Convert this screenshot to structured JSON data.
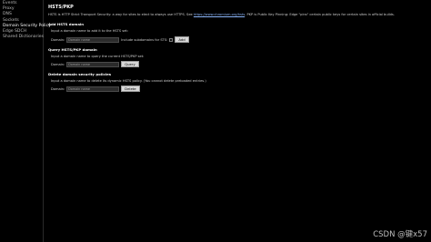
{
  "sidebar": {
    "items": [
      {
        "label": "Events",
        "active": false
      },
      {
        "label": "Proxy",
        "active": false
      },
      {
        "label": "DNS",
        "active": false
      },
      {
        "label": "Sockets",
        "active": false
      },
      {
        "label": "Domain Security Policy",
        "active": true
      },
      {
        "label": "Edge SDCH",
        "active": false
      },
      {
        "label": "Shared Dictionaries",
        "active": false
      }
    ]
  },
  "main": {
    "title": "HSTS/PKP",
    "intro": {
      "before_link": "HSTS is HTTP Strict Transport Security: a way for sites to elect to always use HTTPS. See ",
      "link": "https://www.chromium.org/hsts",
      "after_link": ". PKP is Public Key Pinning: Edge \"pins\" certain public keys for certain sites in official builds."
    },
    "add": {
      "title": "Add HSTS domain",
      "description": "Input a domain name to add it to the HSTS set:",
      "domain_label": "Domain:",
      "domain_placeholder": "Domain name",
      "subdomains_label": "Include subdomains for STS:",
      "button": "Add"
    },
    "query": {
      "title": "Query HSTS/PKP domain",
      "description": "Input a domain name to query the current HSTS/PKP set:",
      "domain_label": "Domain:",
      "domain_placeholder": "Domain name",
      "button": "Query"
    },
    "delete": {
      "title": "Delete domain security policies",
      "description": "Input a domain name to delete its dynamic HSTS policy. (You cannot delete preloaded entries.)",
      "domain_label": "Domain:",
      "domain_placeholder": "Domain name",
      "button": "Delete"
    }
  },
  "watermark": "CSDN @键x57"
}
